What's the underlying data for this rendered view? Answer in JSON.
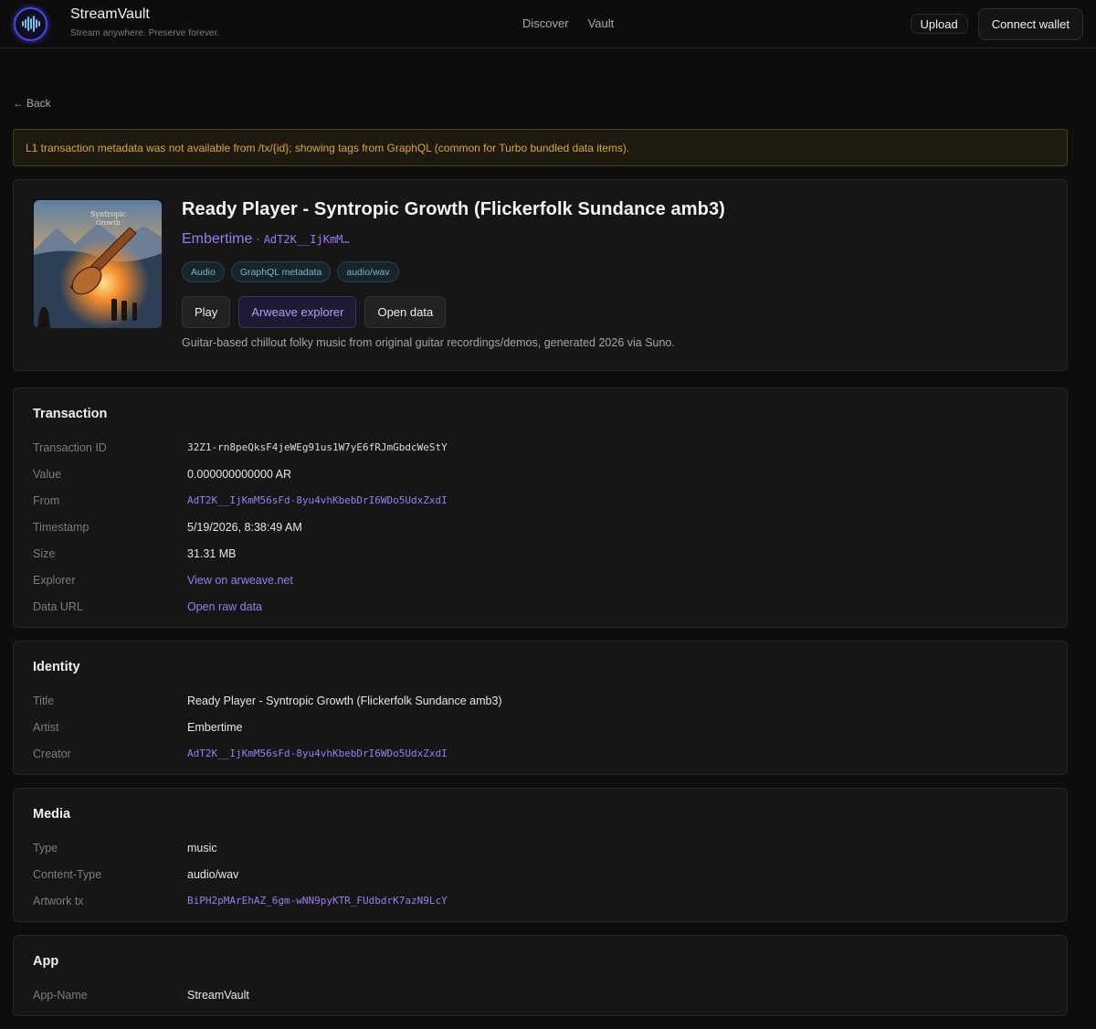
{
  "header": {
    "brand_name": "StreamVault",
    "tagline": "Stream anywhere. Preserve forever.",
    "nav": [
      {
        "label": "Discover"
      },
      {
        "label": "Vault"
      }
    ],
    "upload_label": "Upload",
    "connect_label": "Connect wallet",
    "logo_icon": "soundwave-logo-icon"
  },
  "back_label": "Back",
  "notice": "L1 transaction metadata was not available from /tx/{id}; showing tags from GraphQL (common for Turbo bundled data items).",
  "hero": {
    "title": "Ready Player - Syntropic Growth (Flickerfolk Sundance amb3)",
    "artist": "Embertime",
    "separator": "·",
    "address_short": "AdT2K__IjKmM…",
    "tags": [
      "Audio",
      "GraphQL metadata",
      "audio/wav"
    ],
    "buttons": {
      "play": "Play",
      "explorer": "Arweave explorer",
      "open_data": "Open data"
    },
    "description": "Guitar-based chillout folky music from original guitar recordings/demos, generated 2026 via Suno."
  },
  "transaction": {
    "title": "Transaction",
    "rows": [
      {
        "key": "Transaction ID",
        "value": "32Z1-rn8peQksF4jeWEg91us1W7yE6fRJmGbdcWeStY"
      },
      {
        "key": "Value",
        "value": "0.000000000000 AR"
      },
      {
        "key": "From",
        "value": "AdT2K__IjKmM56sFd-8yu4vhKbebDrI6WDo5UdxZxdI"
      },
      {
        "key": "Timestamp",
        "value": "5/19/2026, 8:38:49 AM"
      },
      {
        "key": "Size",
        "value": "31.31 MB"
      },
      {
        "key": "Explorer",
        "value": "View on arweave.net"
      },
      {
        "key": "Data URL",
        "value": "Open raw data"
      }
    ]
  },
  "identity": {
    "title": "Identity",
    "rows": [
      {
        "key": "Title",
        "value": "Ready Player - Syntropic Growth (Flickerfolk Sundance amb3)"
      },
      {
        "key": "Artist",
        "value": "Embertime"
      },
      {
        "key": "Creator",
        "value": "AdT2K__IjKmM56sFd-8yu4vhKbebDrI6WDo5UdxZxdI"
      }
    ]
  },
  "media": {
    "title": "Media",
    "rows": [
      {
        "key": "Type",
        "value": "music"
      },
      {
        "key": "Content-Type",
        "value": "audio/wav"
      },
      {
        "key": "Artwork tx",
        "value": "BiPH2pMArEhAZ_6gm-wNN9pyKTR_FUdbdrK7azN9LcY"
      }
    ]
  },
  "app": {
    "title": "App",
    "rows": [
      {
        "key": "App-Name",
        "value": "StreamVault"
      }
    ]
  },
  "colors": {
    "accent_purple": "#9b7cf0",
    "notice_text": "#d9a73a",
    "tag_text": "#7fb3c4"
  }
}
